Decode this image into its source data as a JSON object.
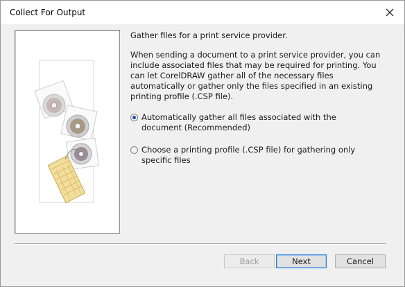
{
  "window": {
    "title": "Collect For Output"
  },
  "icons": {
    "close": "close-icon",
    "illustration": "files-collection-illustration"
  },
  "intro": {
    "heading": "Gather files for a print service provider.",
    "description": "When sending a document to a print service provider, you can include associated files that may be required for printing. You can let CorelDRAW gather all of the necessary files automatically or gather only the files specified in an existing printing profile (.CSP file)."
  },
  "options": [
    {
      "label": "Automatically gather all files associated with the document (Recommended)",
      "selected": true
    },
    {
      "label": "Choose a printing profile (.CSP file) for gathering only specific files",
      "selected": false
    }
  ],
  "buttons": {
    "back": "Back",
    "next": "Next",
    "cancel": "Cancel"
  },
  "colors": {
    "accent": "#2b79d3",
    "radio_dot": "#1d4fa3"
  }
}
